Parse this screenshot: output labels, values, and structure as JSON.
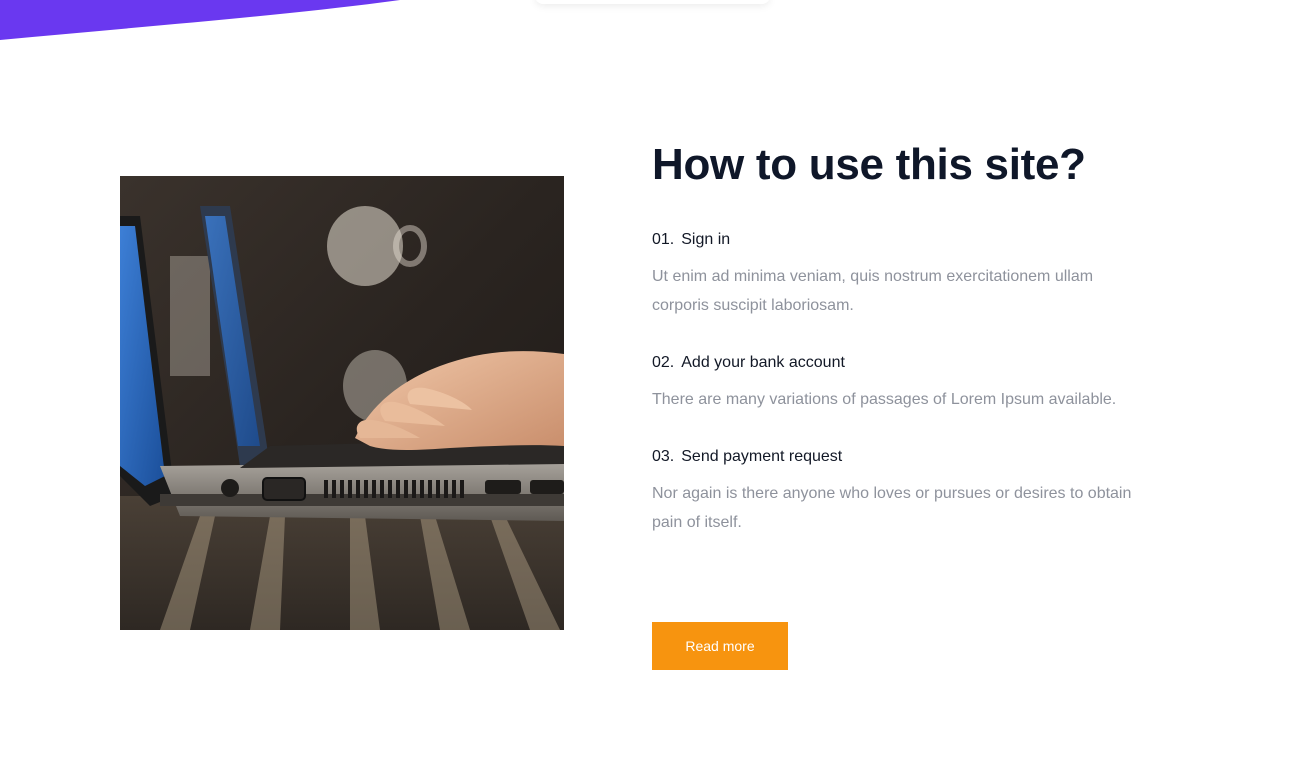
{
  "colors": {
    "accent_purple": "#6a38f0",
    "title_text": "#0f1729",
    "body_text": "#8e929c",
    "button_bg": "#f7940f",
    "button_text": "#ffffff"
  },
  "hero_image": {
    "icon": "laptop-typing-photo"
  },
  "section": {
    "title": "How to use this site?",
    "steps": [
      {
        "number": "01.",
        "title": "Sign in",
        "description": "Ut enim ad minima veniam, quis nostrum exercitationem ullam corporis suscipit laboriosam."
      },
      {
        "number": "02.",
        "title": "Add your bank account",
        "description": "There are many variations of passages of Lorem Ipsum available."
      },
      {
        "number": "03.",
        "title": "Send payment request",
        "description": "Nor again is there anyone who loves or pursues or desires to obtain pain of itself."
      }
    ],
    "button_label": "Read more"
  }
}
